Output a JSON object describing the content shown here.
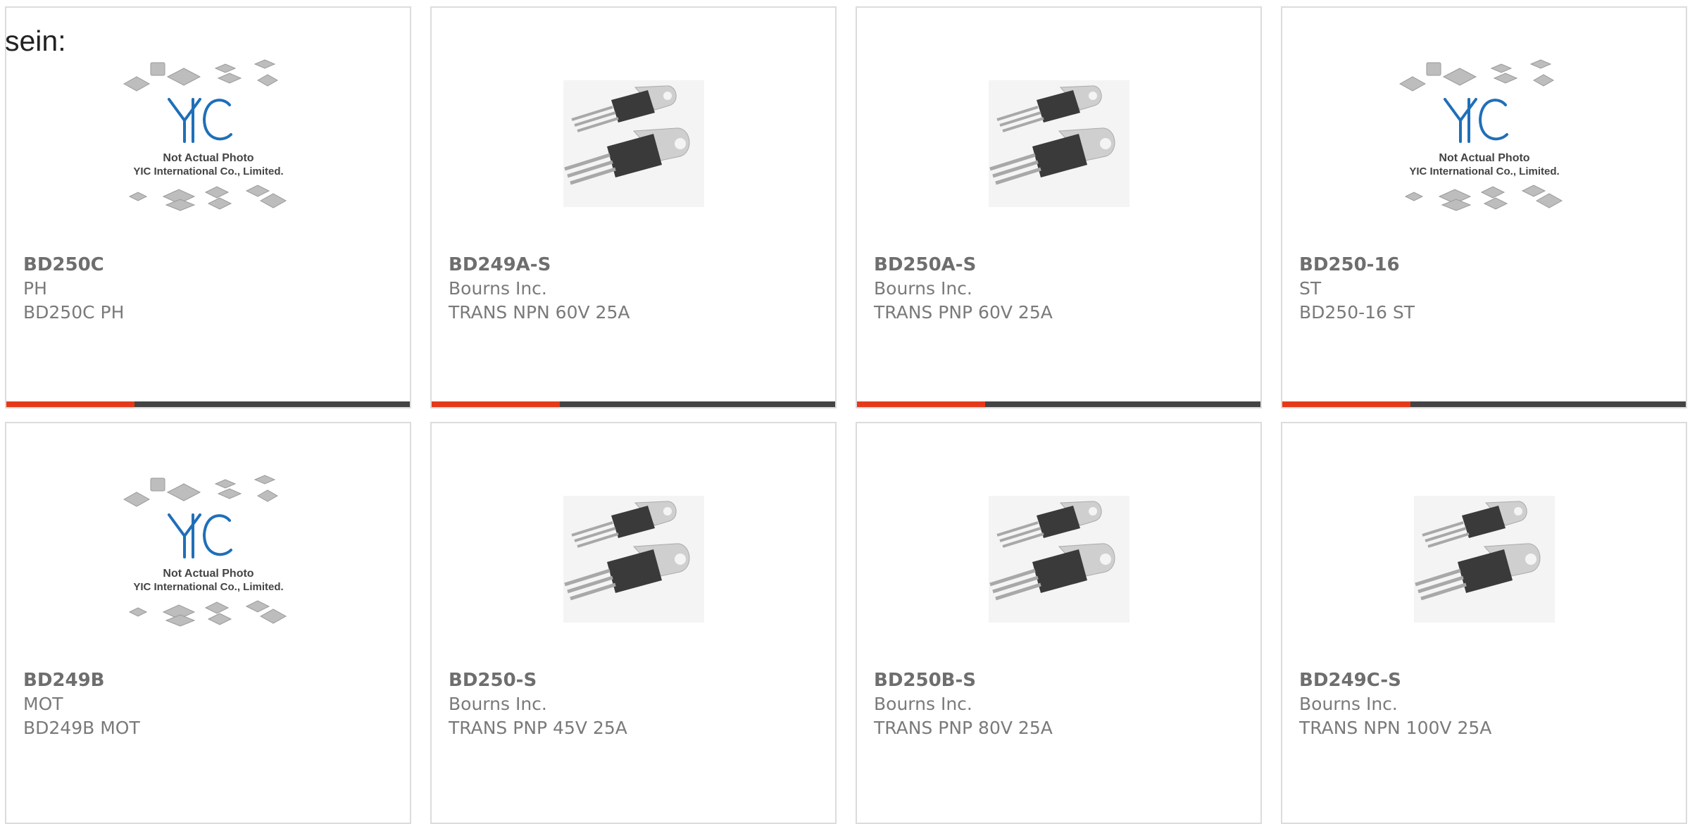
{
  "intro_text": "sein:",
  "products": [
    {
      "part": "BD250C",
      "manufacturer": "PH",
      "description": "BD250C PH",
      "image": "yic-placeholder-image"
    },
    {
      "part": "BD249A-S",
      "manufacturer": "Bourns Inc.",
      "description": "TRANS NPN 60V 25A",
      "image": "to-220-transistor-image"
    },
    {
      "part": "BD250A-S",
      "manufacturer": "Bourns Inc.",
      "description": "TRANS PNP 60V 25A",
      "image": "to-220-transistor-image"
    },
    {
      "part": "BD250-16",
      "manufacturer": "ST",
      "description": "BD250-16 ST",
      "image": "yic-placeholder-image"
    },
    {
      "part": "BD249B",
      "manufacturer": "MOT",
      "description": "BD249B MOT",
      "image": "yic-placeholder-image"
    },
    {
      "part": "BD250-S",
      "manufacturer": "Bourns Inc.",
      "description": "TRANS PNP 45V 25A",
      "image": "to-220-transistor-image"
    },
    {
      "part": "BD250B-S",
      "manufacturer": "Bourns Inc.",
      "description": "TRANS PNP 80V 25A",
      "image": "to-220-transistor-image"
    },
    {
      "part": "BD249C-S",
      "manufacturer": "Bourns Inc.",
      "description": "TRANS NPN 100V 25A",
      "image": "to-220-transistor-image"
    }
  ],
  "placeholder_logo": {
    "brand": "YIC",
    "line1": "Not Actual Photo",
    "line2": "YIC International Co., Limited."
  },
  "colors": {
    "accent": "#e53a1a",
    "bar": "#444444",
    "border": "#dcdcdc",
    "logo_blue": "#1f6fb8"
  }
}
